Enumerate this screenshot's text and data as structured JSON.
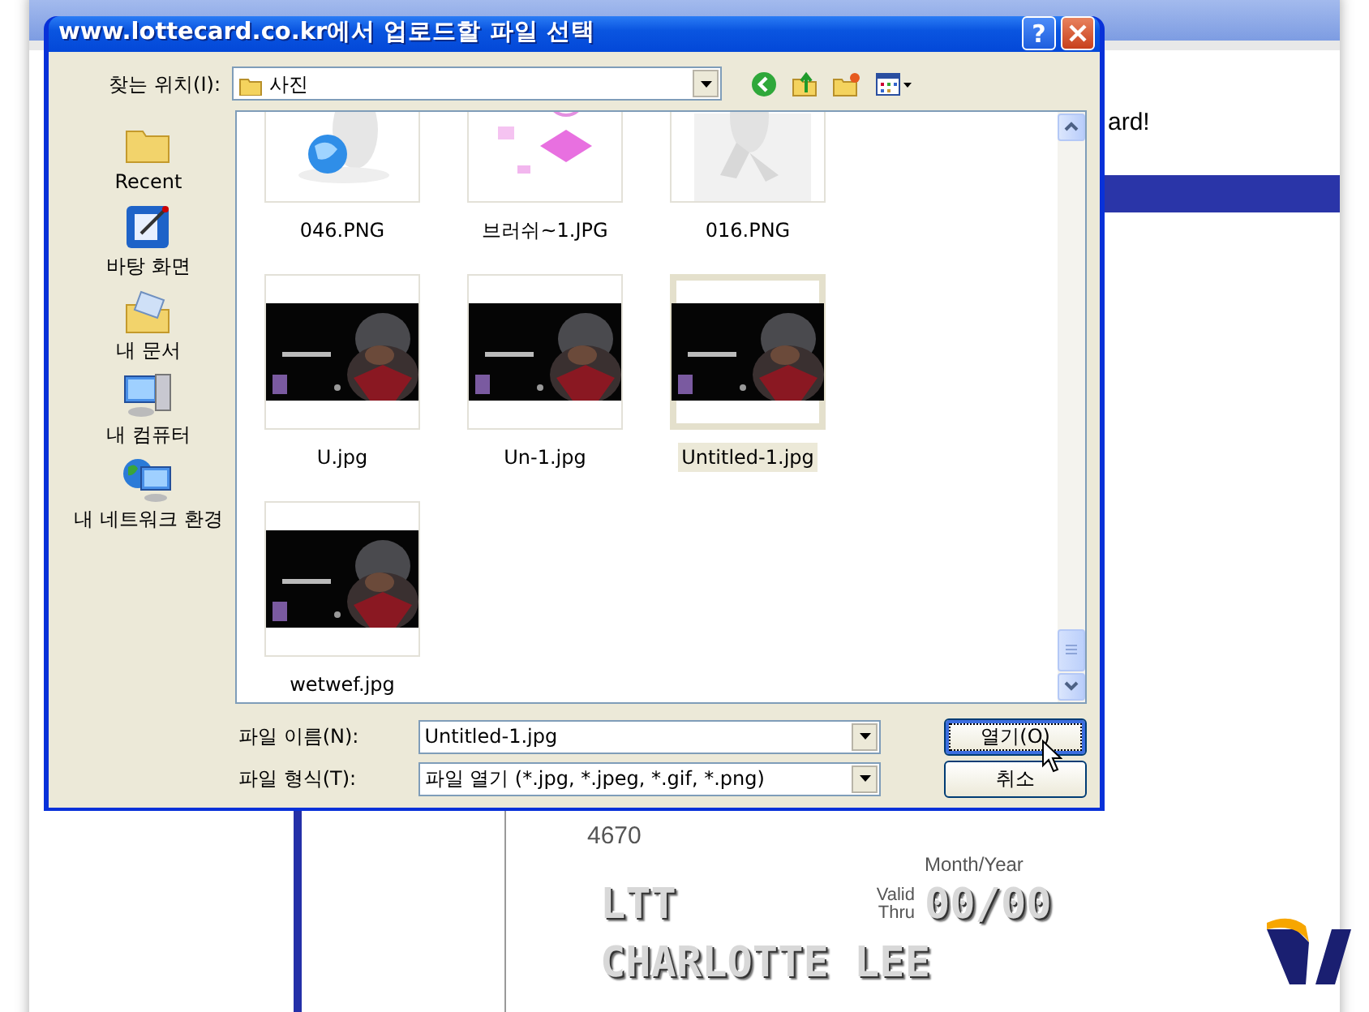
{
  "dialog": {
    "title": "www.lottecard.co.kr에서 업로드할 파일 선택",
    "help": "?"
  },
  "look_in": {
    "label": "찾는 위치(I):",
    "value": "사진"
  },
  "places": [
    {
      "label": "Recent",
      "kind": "recent"
    },
    {
      "label": "바탕 화면",
      "kind": "desktop"
    },
    {
      "label": "내 문서",
      "kind": "documents"
    },
    {
      "label": "내 컴퓨터",
      "kind": "computer"
    },
    {
      "label": "내 네트워크 환경",
      "kind": "network"
    }
  ],
  "files": [
    {
      "name": "046.PNG",
      "selected": false
    },
    {
      "name": "브러쉬~1.JPG",
      "selected": false
    },
    {
      "name": "016.PNG",
      "selected": false
    },
    {
      "name": "U.jpg",
      "selected": false
    },
    {
      "name": "Un-1.jpg",
      "selected": false
    },
    {
      "name": "Untitled-1.jpg",
      "selected": true
    },
    {
      "name": "wetwef.jpg",
      "selected": false
    }
  ],
  "file_name": {
    "label": "파일 이름(N):",
    "value": "Untitled-1.jpg"
  },
  "file_type": {
    "label": "파일 형식(T):",
    "value": "파일 열기 (*.jpg, *.jpeg, *.gif, *.png)"
  },
  "buttons": [
    {
      "label": "열기(O)",
      "default": true
    },
    {
      "label": "취소",
      "default": false
    }
  ],
  "page": {
    "heading_fragment": "ard!",
    "card": {
      "number_suffix": "4670",
      "expiry_caption": "Month/Year",
      "valid_label": "Valid Thru",
      "expiry": "00/00",
      "line_1": "LTT",
      "holder": "CHARLOTTE LEE"
    }
  }
}
